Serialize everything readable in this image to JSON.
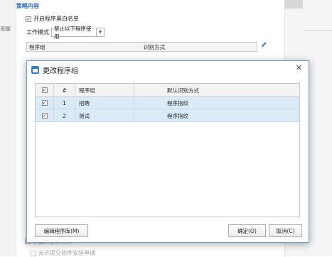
{
  "background": {
    "section_title": "策略内容",
    "left_label": "配置",
    "enable_whitelist": {
      "label": "开启程序黑白名单",
      "checked": true
    },
    "mode": {
      "label": "工作模式",
      "value": "禁止以下程序使用"
    },
    "table_headers": {
      "group": "程序组",
      "recognition": "识别方式"
    },
    "bottom_option_1": "禁止安装新软件",
    "bottom_option_2": "允许提交软件安装申请"
  },
  "dialog": {
    "title": "更改程序组",
    "columns": {
      "number": "#",
      "group": "程序组",
      "recognition": "默认识别方式"
    },
    "rows": [
      {
        "checked": true,
        "number": "1",
        "group": "招聘",
        "recognition": "程序指纹"
      },
      {
        "checked": true,
        "number": "2",
        "group": "测试",
        "recognition": "程序指纹"
      }
    ],
    "buttons": {
      "edit_library": "编辑程序库(M)",
      "ok": "确定(O)",
      "cancel": "取消(C)"
    }
  },
  "colors": {
    "accent": "#2b7fd6",
    "selected_row": "#dbeaf7",
    "dialog_border": "#6f9fd2"
  }
}
